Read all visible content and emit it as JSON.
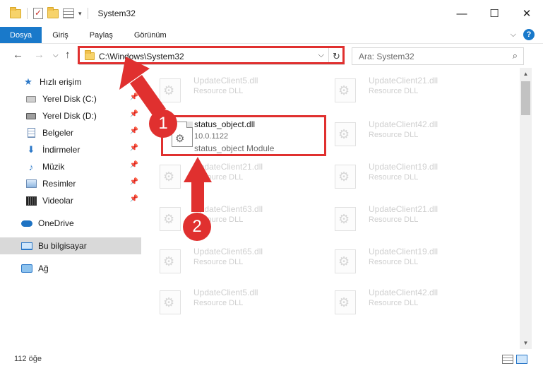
{
  "window": {
    "title": "System32",
    "controls": {
      "minimize": "—",
      "maximize": "☐",
      "close": "✕"
    }
  },
  "ribbon": {
    "tabs": [
      "Dosya",
      "Giriş",
      "Paylaş",
      "Görünüm"
    ],
    "help": "?"
  },
  "address": {
    "path": "C:\\Windows\\System32",
    "search_placeholder": "Ara: System32"
  },
  "sidebar": {
    "items": [
      {
        "label": "Hızlı erişim",
        "icon": "star-icon"
      },
      {
        "label": "Yerel Disk (C:)",
        "icon": "drive-icon",
        "pinned": true
      },
      {
        "label": "Yerel Disk (D:)",
        "icon": "drive-icon",
        "pinned": true
      },
      {
        "label": "Belgeler",
        "icon": "document-icon",
        "pinned": true
      },
      {
        "label": "İndirmeler",
        "icon": "download-icon",
        "pinned": true
      },
      {
        "label": "Müzik",
        "icon": "music-icon",
        "pinned": true
      },
      {
        "label": "Resimler",
        "icon": "pictures-icon",
        "pinned": true
      },
      {
        "label": "Videolar",
        "icon": "video-icon",
        "pinned": true
      },
      {
        "label": "OneDrive",
        "icon": "cloud-icon"
      },
      {
        "label": "Bu bilgisayar",
        "icon": "computer-icon",
        "selected": true
      },
      {
        "label": "Ağ",
        "icon": "network-icon"
      }
    ]
  },
  "files": {
    "left": [
      {
        "name": "UpdateClient5.dll",
        "desc": "Resource DLL"
      },
      {
        "name": "UpdateClient21.dll",
        "desc": "Resource DLL"
      },
      {
        "name": "UpdateClient63.dll",
        "desc": "Resource DLL"
      },
      {
        "name": "UpdateClient65.dll",
        "desc": "Resource DLL"
      },
      {
        "name": "UpdateClient5.dll",
        "desc": "Resource DLL"
      }
    ],
    "right": [
      {
        "name": "UpdateClient21.dll",
        "desc": "Resource DLL"
      },
      {
        "name": "UpdateClient42.dll",
        "desc": "Resource DLL"
      },
      {
        "name": "UpdateClient19.dll",
        "desc": "Resource DLL"
      },
      {
        "name": "UpdateClient21.dll",
        "desc": "Resource DLL"
      },
      {
        "name": "UpdateClient19.dll",
        "desc": "Resource DLL"
      },
      {
        "name": "UpdateClient42.dll",
        "desc": "Resource DLL"
      }
    ],
    "selected": {
      "name": "status_object.dll",
      "version": "10.0.1122",
      "description": "status_object Module"
    }
  },
  "status": {
    "item_count": "112 öğe"
  },
  "annotations": {
    "badge1": "1",
    "badge2": "2",
    "color": "#e0302f"
  }
}
